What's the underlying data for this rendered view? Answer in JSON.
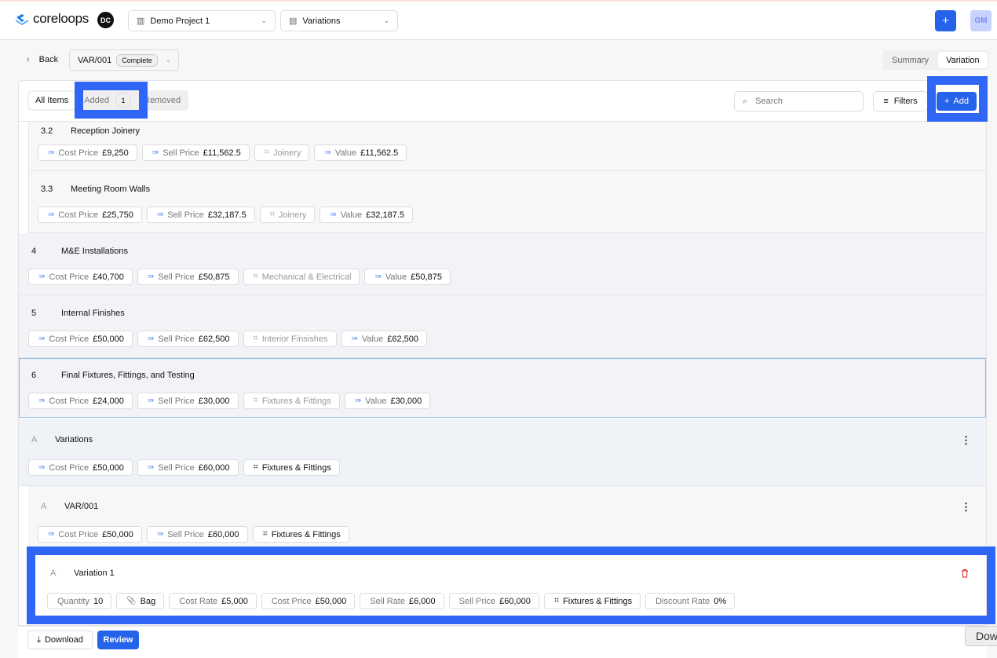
{
  "header": {
    "brand": "coreloops",
    "org_initials": "DC",
    "project": "Demo Project 1",
    "module": "Variations",
    "user_initials": "GM",
    "add_icon": "+"
  },
  "subheader": {
    "back": "Back",
    "variation_id": "VAR/001",
    "status": "Complete",
    "view_tabs": [
      "Summary",
      "Variation"
    ]
  },
  "toolbar": {
    "tabs": [
      {
        "label": "All Items"
      },
      {
        "label": "Added",
        "count": "1"
      },
      {
        "label": "Removed"
      }
    ],
    "search_placeholder": "Search",
    "filters": "Filters",
    "add": "Add"
  },
  "rows": [
    {
      "num": "3.2",
      "title": "Reception Joinery",
      "chips": [
        {
          "t": "m",
          "l": "Cost Price",
          "v": "£9,250"
        },
        {
          "t": "m",
          "l": "Sell Price",
          "v": "£11,562.5"
        },
        {
          "t": "c",
          "v": "Joinery",
          "muted": true
        },
        {
          "t": "m",
          "l": "Value",
          "v": "£11,562.5"
        }
      ]
    },
    {
      "num": "3.3",
      "title": "Meeting Room Walls",
      "chips": [
        {
          "t": "m",
          "l": "Cost Price",
          "v": "£25,750"
        },
        {
          "t": "m",
          "l": "Sell Price",
          "v": "£32,187.5"
        },
        {
          "t": "c",
          "v": "Joinery",
          "muted": true
        },
        {
          "t": "m",
          "l": "Value",
          "v": "£32,187.5"
        }
      ]
    },
    {
      "num": "4",
      "title": "M&E Installations",
      "chips": [
        {
          "t": "m",
          "l": "Cost Price",
          "v": "£40,700"
        },
        {
          "t": "m",
          "l": "Sell Price",
          "v": "£50,875"
        },
        {
          "t": "c",
          "v": "Mechanical & Electrical",
          "muted": true
        },
        {
          "t": "m",
          "l": "Value",
          "v": "£50,875"
        }
      ]
    },
    {
      "num": "5",
      "title": "Internal Finishes",
      "chips": [
        {
          "t": "m",
          "l": "Cost Price",
          "v": "£50,000"
        },
        {
          "t": "m",
          "l": "Sell Price",
          "v": "£62,500"
        },
        {
          "t": "c",
          "v": "Interior Finsishes",
          "muted": true
        },
        {
          "t": "m",
          "l": "Value",
          "v": "£62,500"
        }
      ]
    },
    {
      "num": "6",
      "title": "Final Fixtures, Fittings, and Testing",
      "chips": [
        {
          "t": "m",
          "l": "Cost Price",
          "v": "£24,000"
        },
        {
          "t": "m",
          "l": "Sell Price",
          "v": "£30,000"
        },
        {
          "t": "c",
          "v": "Fixtures & Fittings",
          "muted": true
        },
        {
          "t": "m",
          "l": "Value",
          "v": "£30,000"
        }
      ]
    },
    {
      "num": "A",
      "title": "Variations",
      "chips": [
        {
          "t": "m",
          "l": "Cost Price",
          "v": "£50,000"
        },
        {
          "t": "m",
          "l": "Sell Price",
          "v": "£60,000"
        },
        {
          "t": "c",
          "v": "Fixtures & Fittings"
        }
      ]
    },
    {
      "num": "A",
      "title": "VAR/001",
      "chips": [
        {
          "t": "m",
          "l": "Cost Price",
          "v": "£50,000"
        },
        {
          "t": "m",
          "l": "Sell Price",
          "v": "£60,000"
        },
        {
          "t": "c",
          "v": "Fixtures & Fittings"
        }
      ]
    },
    {
      "num": "A",
      "title": "Variation 1",
      "chips": [
        {
          "t": "p",
          "l": "Quantity",
          "v": "10"
        },
        {
          "t": "u",
          "v": "Bag"
        },
        {
          "t": "p",
          "l": "Cost Rate",
          "v": "£5,000"
        },
        {
          "t": "p",
          "l": "Cost Price",
          "v": "£50,000"
        },
        {
          "t": "p",
          "l": "Sell Rate",
          "v": "£6,000"
        },
        {
          "t": "p",
          "l": "Sell Price",
          "v": "£60,000"
        },
        {
          "t": "c",
          "v": "Fixtures & Fittings"
        },
        {
          "t": "p",
          "l": "Discount Rate",
          "v": "0%"
        }
      ]
    }
  ],
  "footer": {
    "download": "Download",
    "review": "Review",
    "download_tooltip": "Dow"
  },
  "colors": {
    "accent": "#2563eb",
    "delete": "#e53e3e"
  }
}
